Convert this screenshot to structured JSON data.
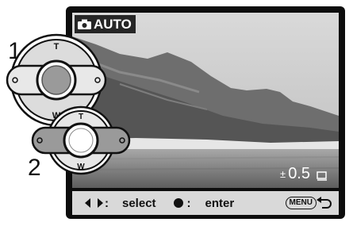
{
  "steps": [
    "1",
    "2"
  ],
  "dial": {
    "top_label": "T",
    "bottom_label": "W"
  },
  "screen": {
    "mode_label": "AUTO",
    "exposure_sign": "±",
    "exposure_value": "0.5",
    "icons": [
      "camera-icon",
      "drive-mode-icon",
      "left-right-arrows-icon",
      "center-button-icon",
      "return-arrow-icon"
    ]
  },
  "guide_bar": {
    "select_label": "select",
    "enter_label": "enter",
    "menu_label": "MENU"
  }
}
